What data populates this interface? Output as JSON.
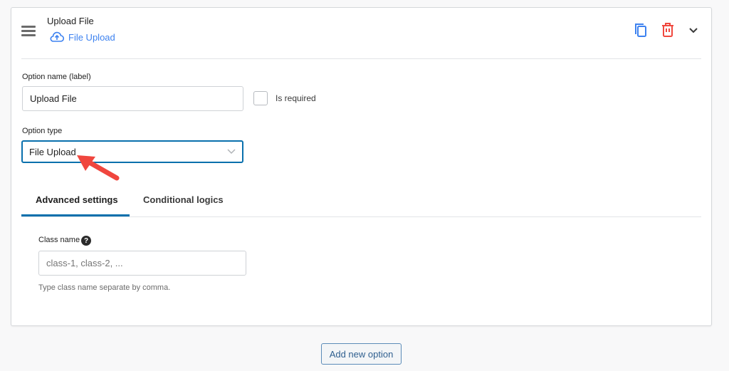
{
  "header": {
    "title": "Upload File",
    "type_label": "File Upload",
    "type_icon": "cloud-upload-icon"
  },
  "actions": {
    "duplicate_icon": "copy-icon",
    "delete_icon": "trash-icon",
    "collapse_icon": "chevron-down-icon"
  },
  "form": {
    "name_label": "Option name (label)",
    "name_value": "Upload File",
    "required_label": "Is required",
    "required_checked": false,
    "type_label": "Option type",
    "type_value": "File Upload"
  },
  "tabs": [
    {
      "label": "Advanced settings",
      "active": true
    },
    {
      "label": "Conditional logics",
      "active": false
    }
  ],
  "advanced": {
    "class_label": "Class name",
    "class_placeholder": "class-1, class-2, ...",
    "class_help": "Type class name separate by comma.",
    "help_icon": "question-icon"
  },
  "footer": {
    "add_label": "Add new option"
  },
  "colors": {
    "accent": "#0a70ad",
    "link": "#3d82f0",
    "danger": "#f0483e",
    "arrow": "#f0463e"
  }
}
